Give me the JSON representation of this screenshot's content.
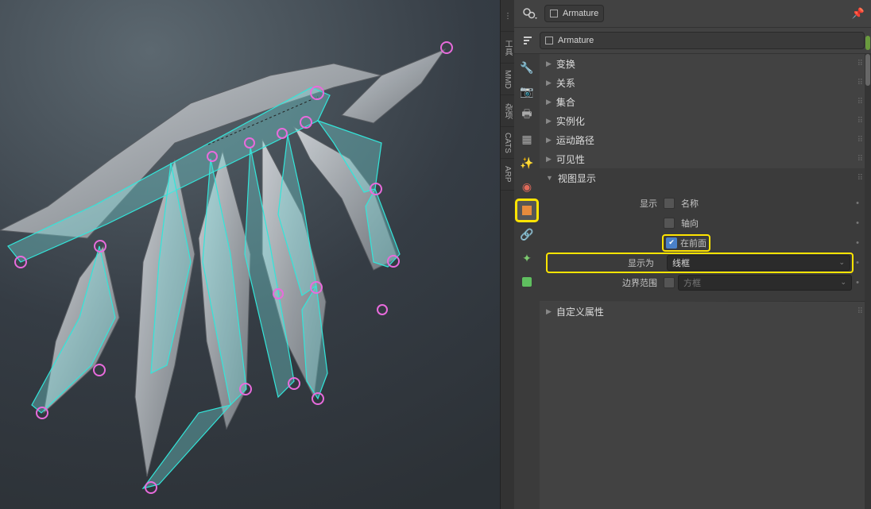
{
  "sidebar": {
    "tabs": [
      "⋯",
      "工具",
      "MMD",
      "杂项",
      "CATS",
      "ARP"
    ]
  },
  "header": {
    "datablock_name": "Armature",
    "breadcrumb_name": "Armature"
  },
  "property_tabs": {
    "icons": [
      "wrench",
      "camera",
      "print",
      "layers",
      "fx",
      "world",
      "const",
      "obj",
      "data"
    ]
  },
  "panels": {
    "transform": "变换",
    "relations": "关系",
    "collections": "集合",
    "instancing": "实例化",
    "motion_paths": "运动路径",
    "visibility": "可见性",
    "viewport_display": "视图显示",
    "custom_properties": "自定义属性"
  },
  "viewport_display": {
    "show_label": "显示",
    "name_label": "名称",
    "axis_label": "轴向",
    "in_front_label": "在前面",
    "display_as_label": "显示为",
    "display_as_value": "线框",
    "bounds_label": "边界范围",
    "bounds_value": "方框",
    "name_checked": false,
    "axis_checked": false,
    "in_front_checked": true,
    "bounds_checked": false
  }
}
